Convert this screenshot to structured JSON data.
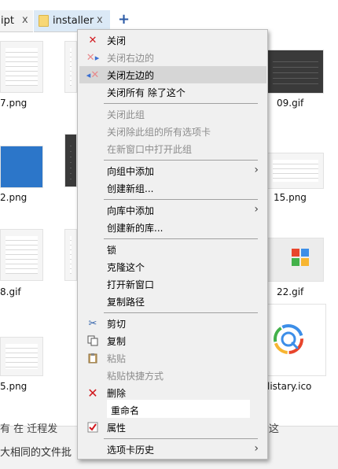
{
  "tabs": {
    "left_tab_label": "ipt",
    "active_tab_label": "installer",
    "close_glyph": "x",
    "add_glyph": "+"
  },
  "files": [
    {
      "name": "7.png"
    },
    {
      "name": "09.gif"
    },
    {
      "name": "2.png"
    },
    {
      "name": "15.png"
    },
    {
      "name": "8.gif"
    },
    {
      "name": "22.gif"
    },
    {
      "name": "5.png"
    },
    {
      "name": "listary.ico"
    }
  ],
  "bottom_text": {
    "line1": "有 在 迁程发",
    "line1_right": "这",
    "line2": "大相同的文件批"
  },
  "menu": {
    "close": "关闭",
    "close_right": "关闭右边的",
    "close_left": "关闭左边的",
    "close_all_except": "关闭所有  除了这个",
    "close_group": "关闭此组",
    "close_all_tabs_except_group": "关闭除此组的所有选项卡",
    "open_group_new_window": "在新窗口中打开此组",
    "add_to_group": "向组中添加",
    "create_group": "创建新组...",
    "add_to_library": "向库中添加",
    "create_library": "创建新的库...",
    "lock": "锁",
    "clone": "克隆这个",
    "open_new_window": "打开新窗口",
    "copy_path": "复制路径",
    "cut": "剪切",
    "copy": "复制",
    "paste": "粘贴",
    "paste_shortcut": "粘贴快捷方式",
    "delete": "删除",
    "rename": "重命名",
    "properties": "属性",
    "tab_history": "选项卡历史"
  },
  "icons": {
    "close": "close-x-icon",
    "close_right": "close-right-icon",
    "close_left": "close-left-icon",
    "cut": "scissors-icon",
    "copy": "copy-icon",
    "paste": "clipboard-icon",
    "delete": "delete-x-icon",
    "properties": "checkmark-properties-icon",
    "submenu": "chevron-right-icon"
  },
  "colors": {
    "active_tab": "#dbe9f6",
    "menu_bg": "#f0f0f0",
    "menu_hover": "#d6d6d6",
    "disabled_text": "#8c8c8c",
    "delete_red": "#d1191e",
    "add_tab_blue": "#2b5aa5"
  }
}
